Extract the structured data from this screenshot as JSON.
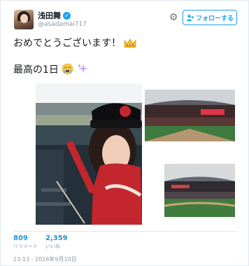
{
  "profile": {
    "display_name": "浅田舞",
    "handle": "@asadamai717",
    "verified_mark": "✓"
  },
  "header": {
    "settings_icon": "gear-icon",
    "follow_label": "フォローする"
  },
  "tweet": {
    "line1_text": "おめでとうございます！",
    "line1_emoji": "crown",
    "line2_text": "最高の1日",
    "line2_emoji_1": "crying-face",
    "line2_emoji_2": "sparkles"
  },
  "stats": {
    "retweets": "809",
    "retweets_label": "リツイート",
    "likes": "2,359",
    "likes_label": "いいね"
  },
  "timestamp": "23:13 - 2016年9月10日",
  "colors": {
    "accent": "#1da1f2",
    "link": "#1b95e0",
    "muted": "#8899a6"
  }
}
